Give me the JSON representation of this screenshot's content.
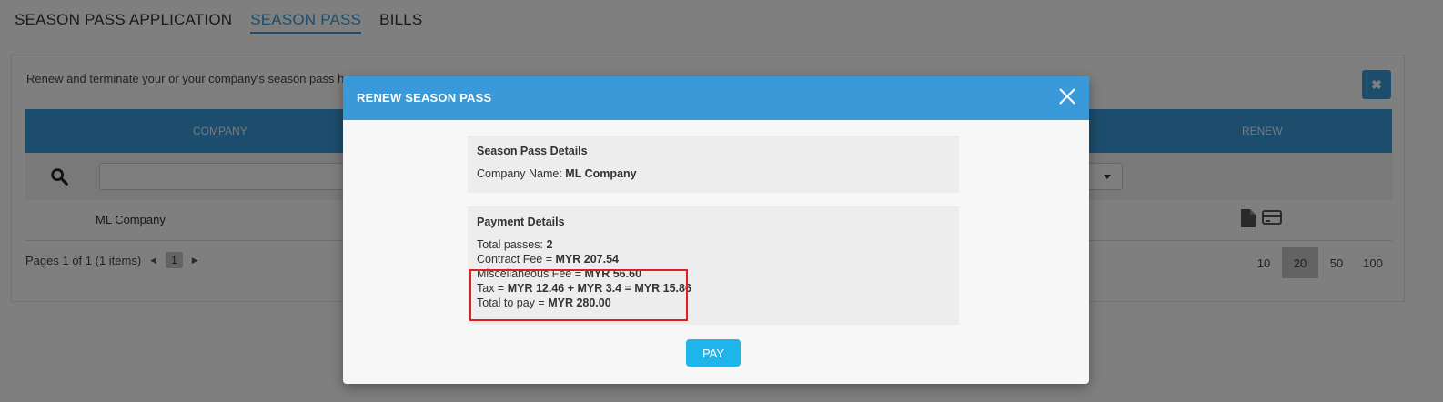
{
  "top_tabs": [
    {
      "label": "SEASON PASS APPLICATION",
      "active": false
    },
    {
      "label": "SEASON PASS",
      "active": true
    },
    {
      "label": "BILLS",
      "active": false
    }
  ],
  "panel": {
    "description": "Renew and terminate your or your company's season pass here.",
    "columns": [
      "COMPANY",
      "RENEW"
    ],
    "rows": [
      {
        "company": "ML Company"
      }
    ],
    "pager": {
      "text": "Pages 1 of 1 (1 items)",
      "current_page": "1"
    },
    "page_sizes": [
      "10",
      "20",
      "50",
      "100"
    ],
    "active_page_size": "20"
  },
  "modal": {
    "title": "RENEW SEASON PASS",
    "details_section": {
      "title": "Season Pass Details",
      "company_label": "Company Name:",
      "company_value": "ML Company"
    },
    "payment_section": {
      "title": "Payment Details",
      "lines": [
        {
          "label": "Total passes:",
          "value": "2"
        },
        {
          "label": "Contract Fee =",
          "value": "MYR 207.54"
        },
        {
          "label": "Miscellaneous Fee =",
          "value": "MYR 56.60"
        },
        {
          "label": "Tax =",
          "value": "MYR 12.46 + MYR 3.4 = MYR 15.86"
        },
        {
          "label": "Total to pay =",
          "value": "MYR 280.00"
        }
      ]
    },
    "pay_label": "PAY"
  },
  "colors": {
    "accent": "#3a9ad9",
    "pay_button": "#1fb4ea",
    "highlight_border": "#e02020"
  }
}
